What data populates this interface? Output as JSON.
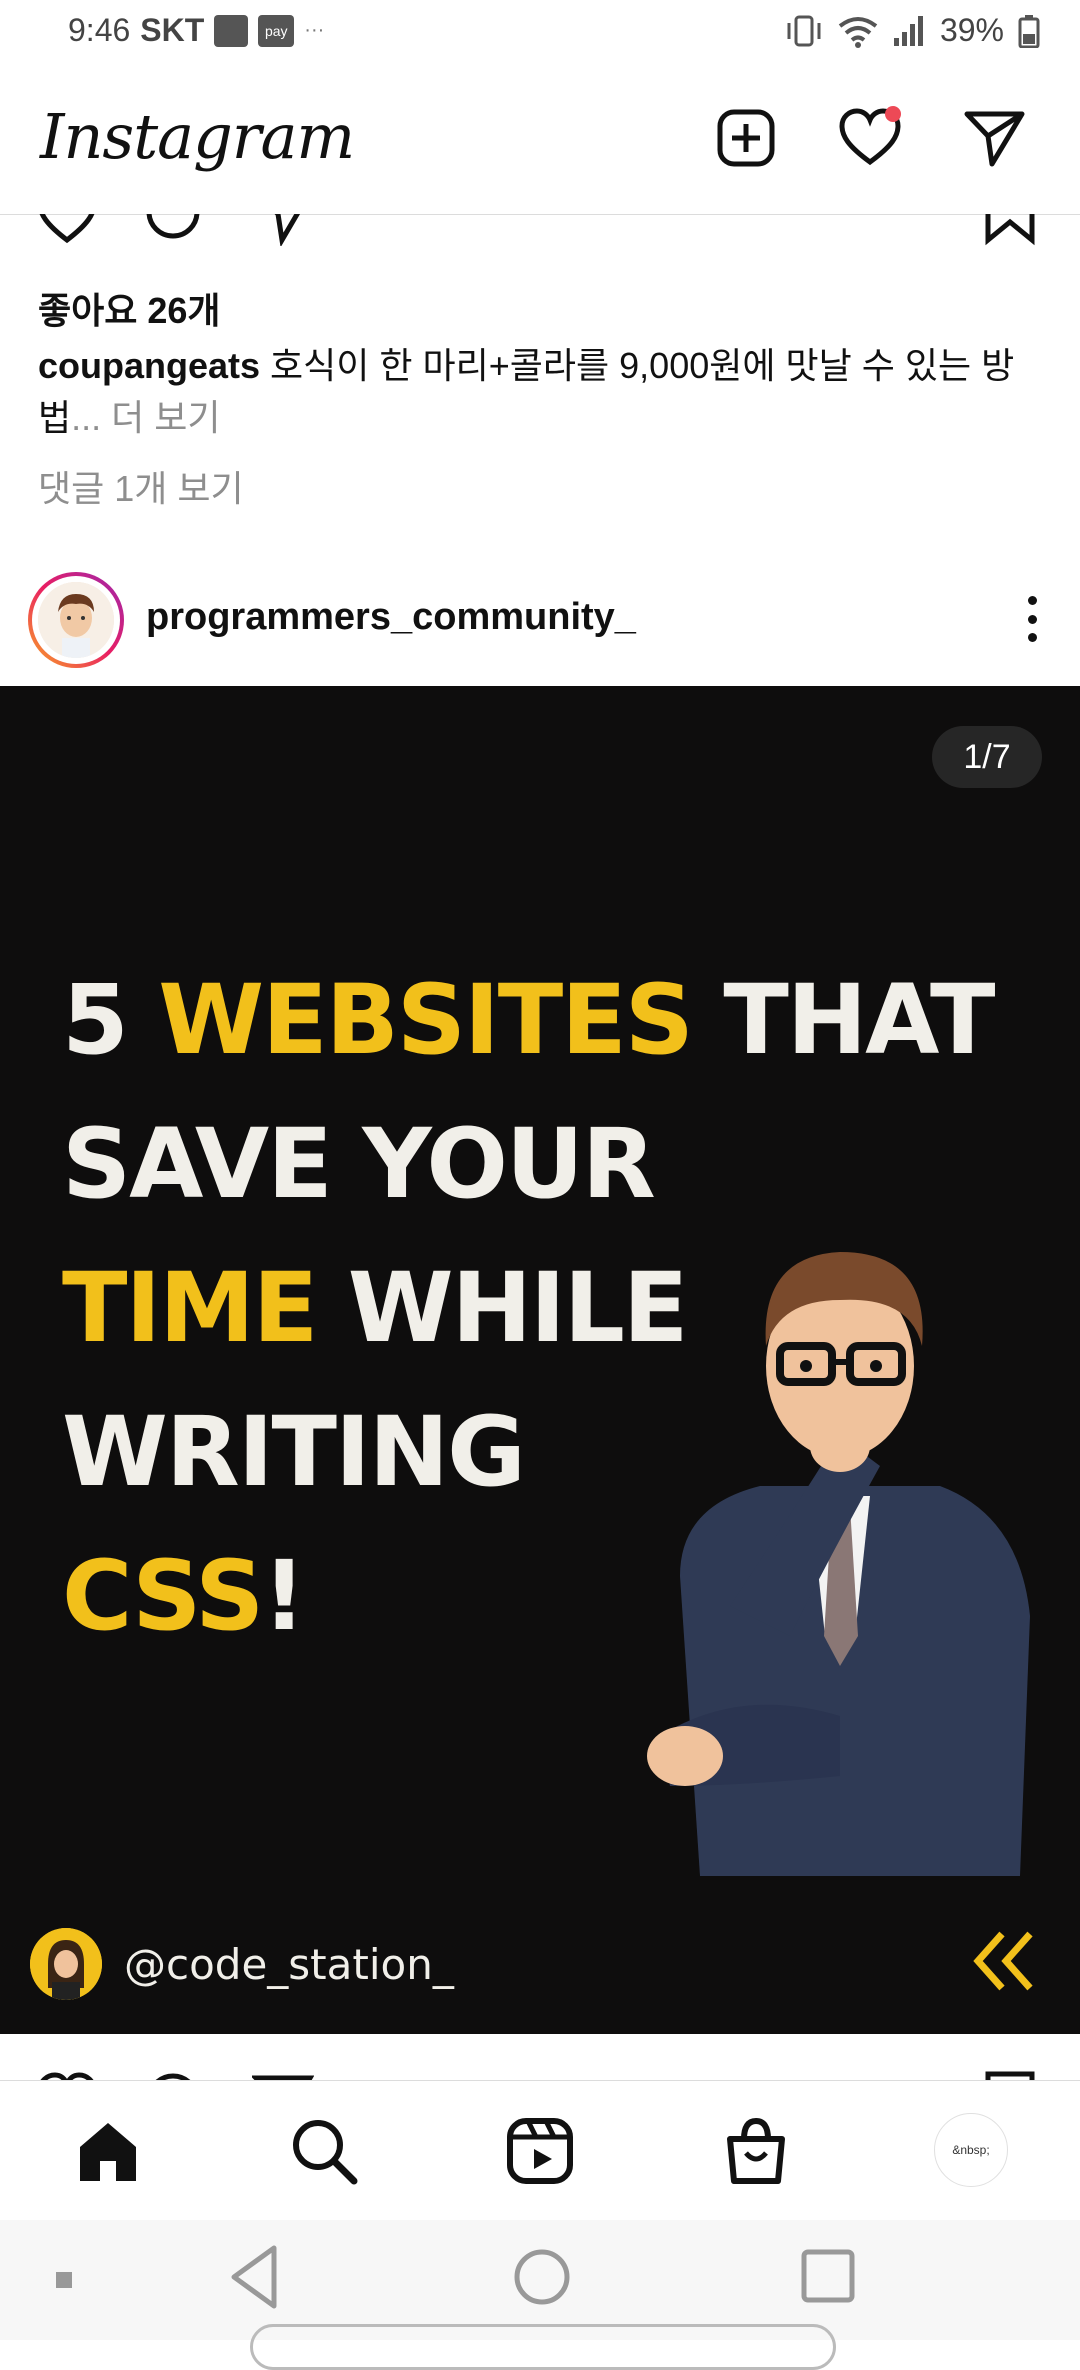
{
  "status_bar": {
    "time": "9:46",
    "carrier": "SKT",
    "pay_label": "pay",
    "dots": "···",
    "battery": "39%"
  },
  "top_bar": {
    "logo": "Instagram"
  },
  "previous_post": {
    "likes": "좋아요 26개",
    "caption_user": "coupangeats",
    "caption_text": " 호식이 한 마리+콜라를 9,000원에 맛날 수 있는 방법",
    "more": "... 더 보기",
    "comments": "댓글 1개 보기"
  },
  "post": {
    "username": "programmers_community_",
    "counter": "1/7",
    "headline": {
      "line1_a": "5 ",
      "line1_b": "WEBSITES",
      "line1_c": " THAT",
      "line2": "SAVE YOUR",
      "line3_a": "TIME",
      "line3_b": " WHILE",
      "line4": "WRITING",
      "line5_a": "CSS",
      "line5_b": "!"
    },
    "handle": "@code_station_"
  },
  "bottom_nav": {
    "profile_text": "&nbsp;"
  },
  "colors": {
    "accent_yellow": "#f2c01b",
    "notification_red": "#ed4956",
    "post_bg": "#0e0d0d"
  }
}
